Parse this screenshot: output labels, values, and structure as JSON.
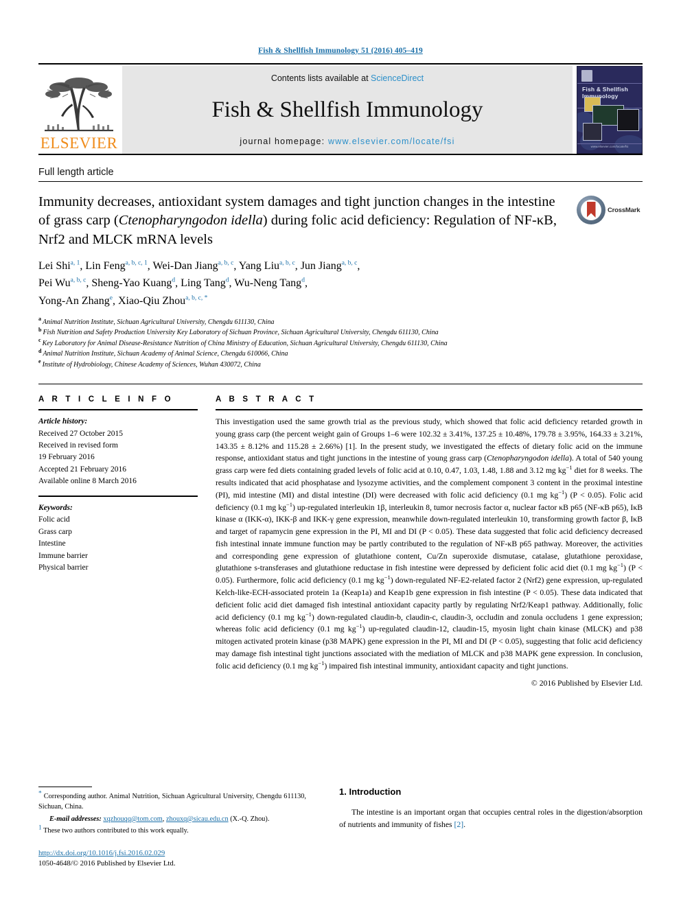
{
  "running_head": "Fish & Shellfish Immunology 51 (2016) 405–419",
  "masthead": {
    "contents_prefix": "Contents lists available at",
    "sciencedirect": "ScienceDirect",
    "journal_name": "Fish & Shellfish Immunology",
    "homepage_label": "journal homepage:",
    "homepage_url": "www.elsevier.com/locate/fsi",
    "elsevier_wordmark": "ELSEVIER",
    "cover_title": "Fish & Shellfish Immunology",
    "cover_footer": "www.elsevier.com/locate/fsi",
    "link_color": "#2b8fc9",
    "elsevier_orange": "#f08c1b"
  },
  "article_type": "Full length article",
  "title": {
    "part1": "Immunity decreases, antioxidant system damages and tight junction changes in the intestine of grass carp (",
    "species": "Ctenopharyngodon idella",
    "part2": ") during folic acid deficiency: Regulation of NF-κB, Nrf2 and MLCK mRNA levels"
  },
  "crossmark": {
    "label": "CrossMark"
  },
  "authors": [
    {
      "name": "Lei Shi",
      "sup": "a, 1",
      "sep": ","
    },
    {
      "name": "Lin Feng",
      "sup": "a, b, c, 1",
      "sep": ","
    },
    {
      "name": "Wei-Dan Jiang",
      "sup": "a, b, c",
      "sep": ","
    },
    {
      "name": "Yang Liu",
      "sup": "a, b, c",
      "sep": ","
    },
    {
      "name": "Jun Jiang",
      "sup": "a, b, c",
      "sep": ","
    },
    {
      "name": "Pei Wu",
      "sup": "a, b, c",
      "sep": ","
    },
    {
      "name": "Sheng-Yao Kuang",
      "sup": "d",
      "sep": ","
    },
    {
      "name": "Ling Tang",
      "sup": "d",
      "sep": ","
    },
    {
      "name": "Wu-Neng Tang",
      "sup": "d",
      "sep": ","
    },
    {
      "name": "Yong-An Zhang",
      "sup": "e",
      "sep": ","
    },
    {
      "name": "Xiao-Qiu Zhou",
      "sup": "a, b, c, *",
      "sep": ""
    }
  ],
  "affiliations": [
    {
      "marker": "a",
      "text": "Animal Nutrition Institute, Sichuan Agricultural University, Chengdu 611130, China"
    },
    {
      "marker": "b",
      "text": "Fish Nutrition and Safety Production University Key Laboratory of Sichuan Province, Sichuan Agricultural University, Chengdu 611130, China"
    },
    {
      "marker": "c",
      "text": "Key Laboratory for Animal Disease-Resistance Nutrition of China Ministry of Education, Sichuan Agricultural University, Chengdu 611130, China"
    },
    {
      "marker": "d",
      "text": "Animal Nutrition Institute, Sichuan Academy of Animal Science, Chengdu 610066, China"
    },
    {
      "marker": "e",
      "text": "Institute of Hydrobiology, Chinese Academy of Sciences, Wuhan 430072, China"
    }
  ],
  "article_info": {
    "heading": "A R T I C L E   I N F O",
    "history_label": "Article history:",
    "history": [
      "Received 27 October 2015",
      "Received in revised form",
      "19 February 2016",
      "Accepted 21 February 2016",
      "Available online 8 March 2016"
    ],
    "keywords_label": "Keywords:",
    "keywords": [
      "Folic acid",
      "Grass carp",
      "Intestine",
      "Immune barrier",
      "Physical barrier"
    ]
  },
  "abstract": {
    "heading": "A B S T R A C T",
    "p1": "This investigation used the same growth trial as the previous study, which showed that folic acid deficiency retarded growth in young grass carp (the percent weight gain of Groups 1–6 were 102.32 ± 3.41%, 137.25 ± 10.48%, 179.78 ± 3.95%, 164.33 ± 3.21%, 143.35 ± 8.12% and 115.28 ± 2.66%) [1]. In the present study, we investigated the effects of dietary folic acid on the immune response, antioxidant status and tight junctions in the intestine of young grass carp (",
    "species": "Ctenopharyngodon idella",
    "p2": "). A total of 540 young grass carp were fed diets containing graded levels of folic acid at 0.10, 0.47, 1.03, 1.48, 1.88 and 3.12 mg kg",
    "sup1": "−1",
    "p3": " diet for 8 weeks. The results indicated that acid phosphatase and lysozyme activities, and the complement component 3 content in the proximal intestine (PI), mid intestine (MI) and distal intestine (DI) were decreased with folic acid deficiency (0.1 mg kg",
    "sup2": "−1",
    "p4": ") (P < 0.05). Folic acid deficiency (0.1 mg kg",
    "sup3": "−1",
    "p5": ") up-regulated interleukin 1β, interleukin 8, tumor necrosis factor α, nuclear factor κB p65 (NF-κB p65), IκB kinase α (IKK-α), IKK-β and IKK-γ gene expression, meanwhile down-regulated interleukin 10, transforming growth factor β, IκB and target of rapamycin gene expression in the PI, MI and DI (P < 0.05). These data suggested that folic acid deficiency decreased fish intestinal innate immune function may be partly contributed to the regulation of NF-κB p65 pathway. Moreover, the activities and corresponding gene expression of glutathione content, Cu/Zn superoxide dismutase, catalase, glutathione peroxidase, glutathione s-transferases and glutathione reductase in fish intestine were depressed by deficient folic acid diet (0.1 mg kg",
    "sup4": "−1",
    "p6": ") (P < 0.05). Furthermore, folic acid deficiency (0.1 mg kg",
    "sup5": "−1",
    "p7": ") down-regulated NF-E2-related factor 2 (Nrf2) gene expression, up-regulated Kelch-like-ECH-associated protein 1a (Keap1a) and Keap1b gene expression in fish intestine (P < 0.05). These data indicated that deficient folic acid diet damaged fish intestinal antioxidant capacity partly by regulating Nrf2/Keap1 pathway. Additionally, folic acid deficiency (0.1 mg kg",
    "sup6": "−1",
    "p8": ") down-regulated claudin-b, claudin-c, claudin-3, occludin and zonula occludens 1 gene expression; whereas folic acid deficiency (0.1 mg kg",
    "sup7": "−1",
    "p9": ") up-regulated claudin-12, claudin-15, myosin light chain kinase (MLCK) and p38 mitogen activated protein kinase (p38 MAPK) gene expression in the PI, MI and DI (P < 0.05), suggesting that folic acid deficiency may damage fish intestinal tight junctions associated with the mediation of MLCK and p38 MAPK gene expression. In conclusion, folic acid deficiency (0.1 mg kg",
    "sup8": "−1",
    "p10": ") impaired fish intestinal immunity, antioxidant capacity and tight junctions.",
    "copyright": "© 2016 Published by Elsevier Ltd."
  },
  "footnotes": {
    "corresponding": "Corresponding author. Animal Nutrition, Sichuan Agricultural University, Chengdu 611130, Sichuan, China.",
    "email_label": "E-mail addresses:",
    "email1": "xqzhouqq@tom.com",
    "email2": "zhouxq@sicau.edu.cn",
    "email_suffix": "(X.-Q. Zhou).",
    "equal_contrib_marker": "1",
    "equal_contrib": "These two authors contributed to this work equally."
  },
  "doi": {
    "url": "http://dx.doi.org/10.1016/j.fsi.2016.02.029",
    "issn": "1050-4648/© 2016 Published by Elsevier Ltd."
  },
  "introduction": {
    "heading": "1. Introduction",
    "p1_a": "The intestine is an important organ that occupies central roles in the digestion/absorption of nutrients and immunity of fishes ",
    "ref": "[2]",
    "p1_b": "."
  }
}
